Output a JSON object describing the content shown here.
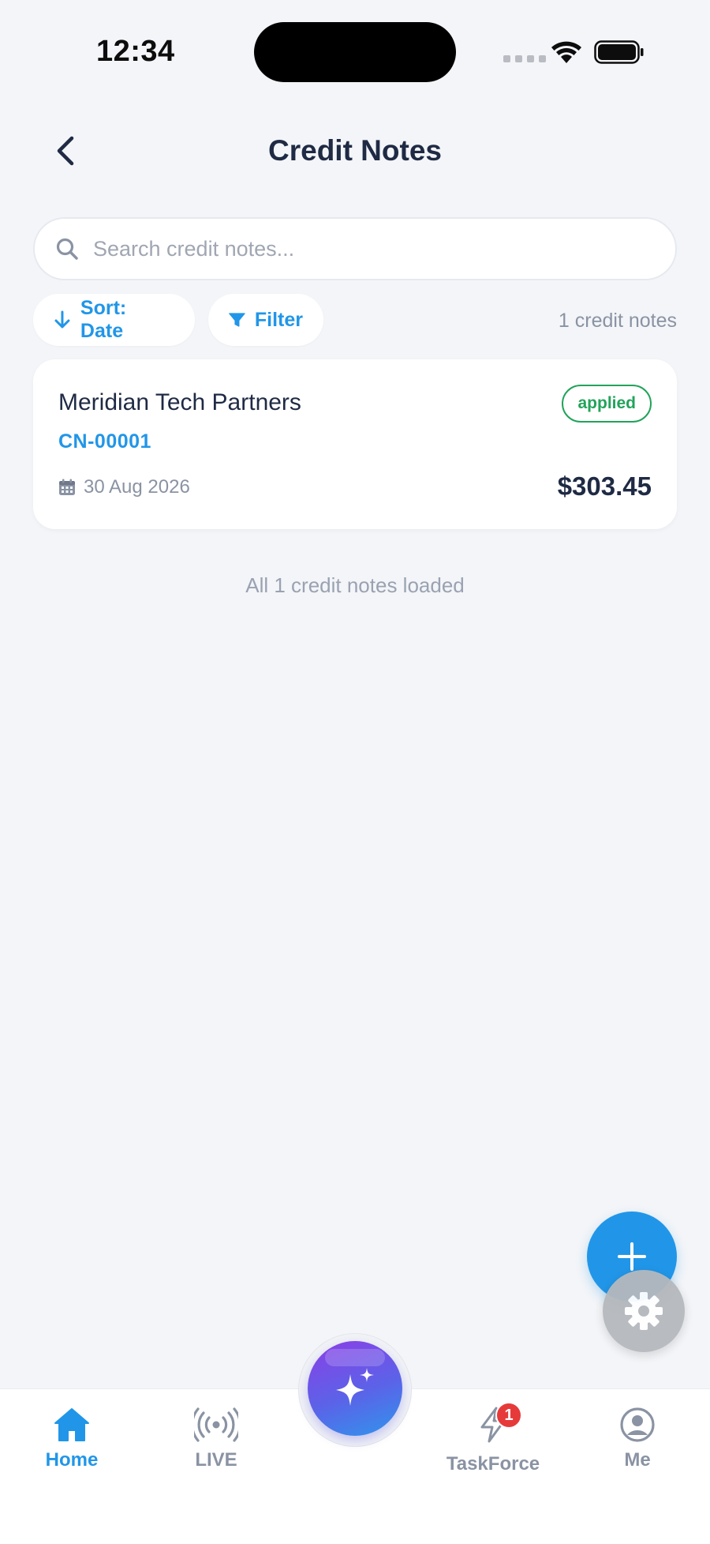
{
  "status_bar": {
    "time": "12:34"
  },
  "header": {
    "title": "Credit Notes"
  },
  "search": {
    "placeholder": "Search credit notes..."
  },
  "toolbar": {
    "sort_label": "Sort: Date",
    "filter_label": "Filter",
    "count_text": "1 credit notes"
  },
  "credit_notes": [
    {
      "client": "Meridian Tech Partners",
      "status": "applied",
      "number": "CN-00001",
      "date": "30 Aug 2026",
      "amount": "$303.45"
    }
  ],
  "list_footer": "All 1 credit notes loaded",
  "tab_bar": {
    "tabs": [
      {
        "label": "Home",
        "icon": "home-icon",
        "active": true
      },
      {
        "label": "LIVE",
        "icon": "broadcast-icon",
        "active": false
      },
      {
        "label": "TaskForce",
        "icon": "lightning-icon",
        "active": false,
        "badge": "1"
      },
      {
        "label": "Me",
        "icon": "user-icon",
        "active": false
      }
    ]
  },
  "colors": {
    "accent": "#2196e8",
    "status_applied": "#22a35a",
    "badge_red": "#e63a3a",
    "background": "#f3f5f8"
  }
}
